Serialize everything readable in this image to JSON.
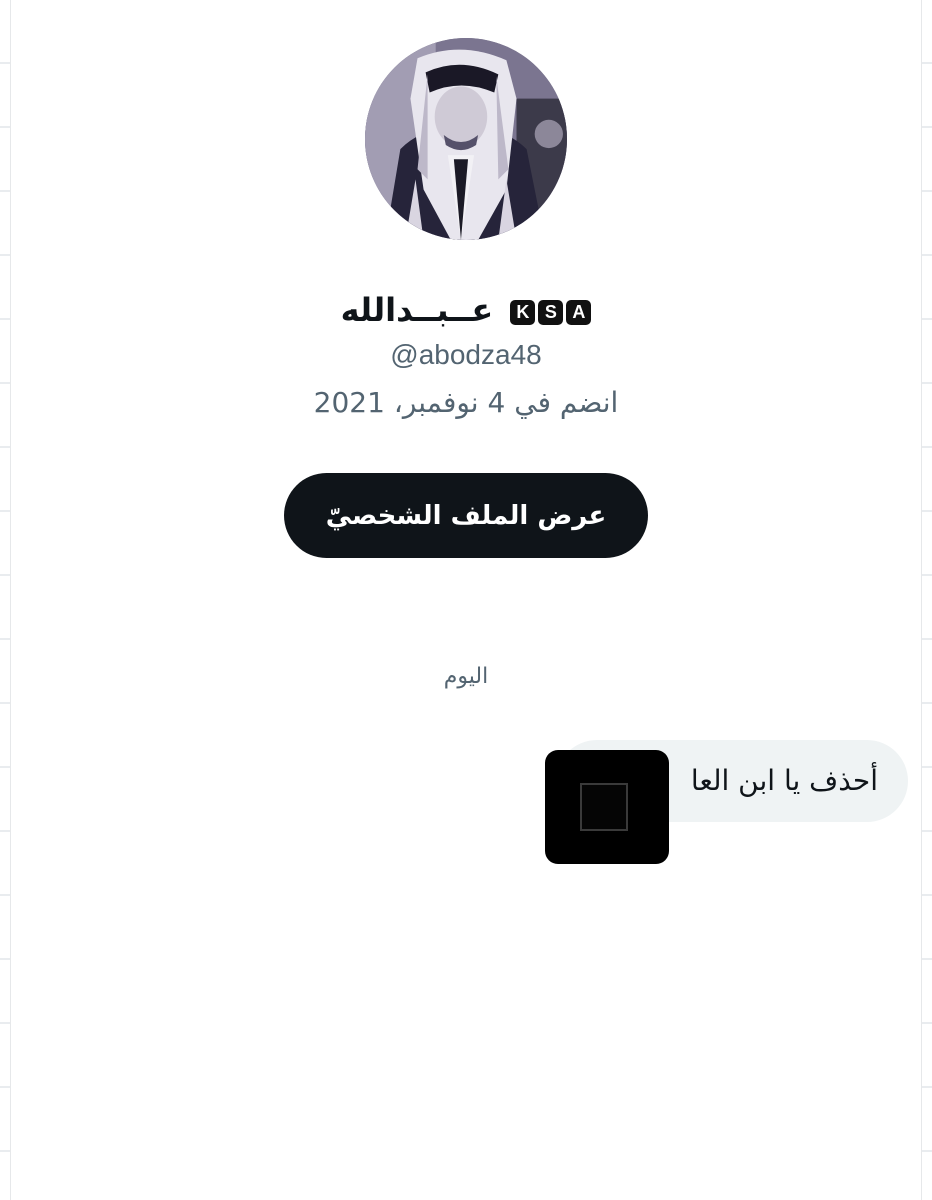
{
  "profile": {
    "display_name": "عــبــدالله",
    "badges": [
      "K",
      "S",
      "A"
    ],
    "handle": "@abodza48",
    "joined": "انضم في 4 نوفمبر، 2021",
    "view_profile_label": "عرض الملف الشخصيّ"
  },
  "conversation": {
    "day_label": "اليوم",
    "messages": [
      {
        "text": "أحذف يا ابن العا"
      }
    ]
  },
  "colors": {
    "primary_text": "#0f1419",
    "secondary_text": "#536471",
    "button_bg": "#0f1419",
    "bubble_bg": "#eff3f4"
  }
}
